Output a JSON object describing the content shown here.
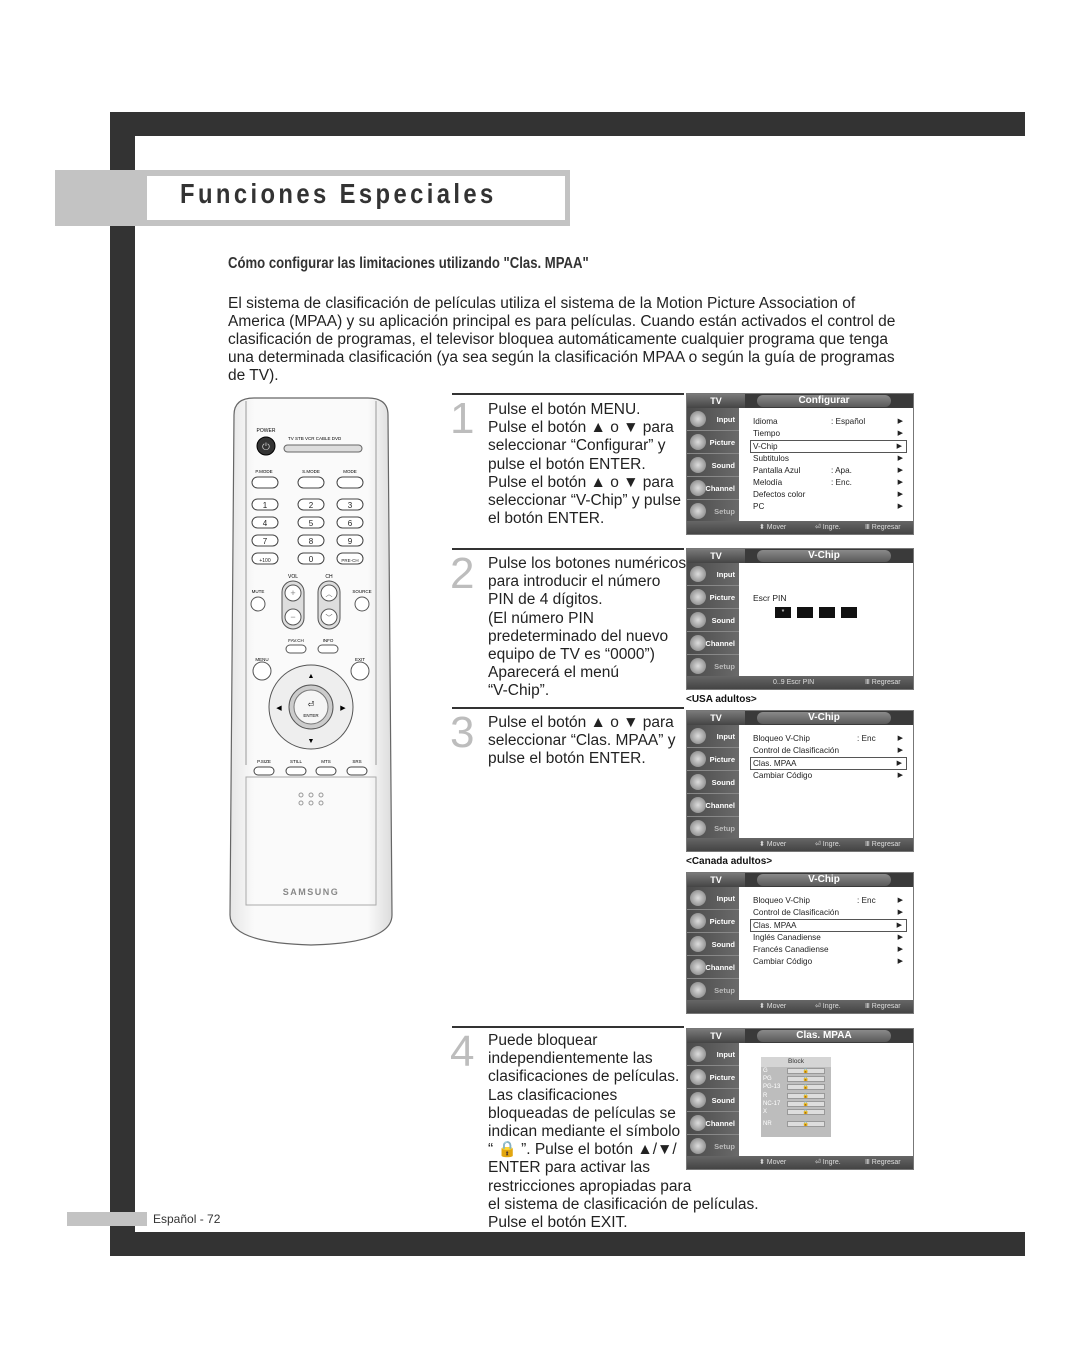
{
  "header": {
    "section_title": "Funciones Especiales",
    "subtitle": "Cómo configurar las limitaciones utilizando \"Clas. MPAA\""
  },
  "intro": "El sistema de clasificación de películas utiliza el sistema de la Motion Picture Association of America (MPAA) y su aplicación principal es para películas. Cuando están activados el control de clasificación de programas, el televisor bloquea automáticamente cualquier programa que tenga una determinada clasificación (ya sea según la clasificación MPAA o según la guía de programas de TV).",
  "remote": {
    "power_label": "POWER",
    "sources": [
      "TV",
      "STB",
      "VCR",
      "CABLE",
      "DVD"
    ],
    "mode_labels": [
      "P.MODE",
      "S.MODE",
      "MODE"
    ],
    "digits": [
      "1",
      "2",
      "3",
      "4",
      "5",
      "6",
      "7",
      "8",
      "9",
      "+100",
      "0",
      "PRE-CH"
    ],
    "vol_label": "VOL",
    "ch_label": "CH",
    "mute_label": "MUTE",
    "source_label": "SOURCE",
    "fav_label": "FAV.CH",
    "info_label": "INFO",
    "menu_label": "MENU",
    "exit_label": "EXIT",
    "enter_label": "ENTER",
    "bottom_labels": [
      "P.SIZE",
      "STILL",
      "MTS",
      "SRS"
    ],
    "brand": "SAMSUNG"
  },
  "steps": [
    {
      "num": "1",
      "text": "Pulse el botón MENU.\nPulse el botón ▲ o ▼ para\nseleccionar “Configurar” y\npulse el botón ENTER.\nPulse el botón ▲ o ▼ para\nseleccionar “V-Chip” y pulse\nel botón ENTER."
    },
    {
      "num": "2",
      "text": "Pulse los botones numéricos\npara introducir el número\nPIN de 4 dígitos.\n(El número PIN\npredeterminado del nuevo\nequipo de TV es “0000”)\nAparecerá el menú\n“V-Chip”."
    },
    {
      "num": "3",
      "text": "Pulse el botón ▲ o ▼ para\nseleccionar “Clas. MPAA” y\npulse el botón ENTER."
    },
    {
      "num": "4",
      "text": "Puede bloquear\nindependientemente las\nclasificaciones de películas.\nLas clasificaciones\nbloqueadas de películas se\nindican mediante el símbolo\n“ 🔒 ”. Pulse el botón ▲/▼/\nENTER para activar las\nrestricciones apropiadas para\nel sistema de clasificación de películas.\nPulse el botón EXIT."
    }
  ],
  "tv_common": {
    "tv_label": "TV",
    "sidebar": [
      "Input",
      "Picture",
      "Sound",
      "Channel",
      "Setup"
    ],
    "footer_move": "⬍ Mover",
    "footer_enter": "⏎ Ingre.",
    "footer_return": "Ⅲ Regresar"
  },
  "screens": {
    "configurar": {
      "title": "Configurar",
      "items": [
        {
          "label": "Idioma",
          "value": ": Español"
        },
        {
          "label": "Tiempo",
          "value": ""
        },
        {
          "label": "V-Chip",
          "value": "",
          "selected": true
        },
        {
          "label": "Subtitulos",
          "value": ""
        },
        {
          "label": "Pantalla Azul",
          "value": ": Apa."
        },
        {
          "label": "Melodía",
          "value": ": Enc."
        },
        {
          "label": "Defectos color",
          "value": ""
        },
        {
          "label": "PC",
          "value": ""
        }
      ]
    },
    "pin": {
      "title": "V-Chip",
      "prompt": "Escr PIN",
      "boxes": [
        "*",
        "",
        "",
        ""
      ],
      "footer_left": "0..9 Escr PIN",
      "footer_return": "Ⅲ Regresar"
    },
    "usa_label": "<USA adultos>",
    "vchip_usa": {
      "title": "V-Chip",
      "items": [
        {
          "label": "Bloqueo V-Chip",
          "value": ": Enc"
        },
        {
          "label": "Control de Clasificación",
          "value": ""
        },
        {
          "label": "Clas. MPAA",
          "value": "",
          "selected": true
        },
        {
          "label": "Cambiar Código",
          "value": ""
        }
      ]
    },
    "canada_label": "<Canada adultos>",
    "vchip_canada": {
      "title": "V-Chip",
      "items": [
        {
          "label": "Bloqueo V-Chip",
          "value": ": Enc"
        },
        {
          "label": "Control de Clasificación",
          "value": ""
        },
        {
          "label": "Clas. MPAA",
          "value": "",
          "selected": true
        },
        {
          "label": "Inglés Canadiense",
          "value": ""
        },
        {
          "label": "Francés Canadiense",
          "value": ""
        },
        {
          "label": "Cambiar Código",
          "value": ""
        }
      ]
    },
    "mpaa": {
      "title": "Clas. MPAA",
      "column_header": "Block",
      "ratings": [
        "G",
        "PG",
        "PG-13",
        "R",
        "NC-17",
        "X"
      ],
      "nr": "NR",
      "lock_symbol": "🔒"
    }
  },
  "footer": {
    "page": "Español - 72"
  }
}
